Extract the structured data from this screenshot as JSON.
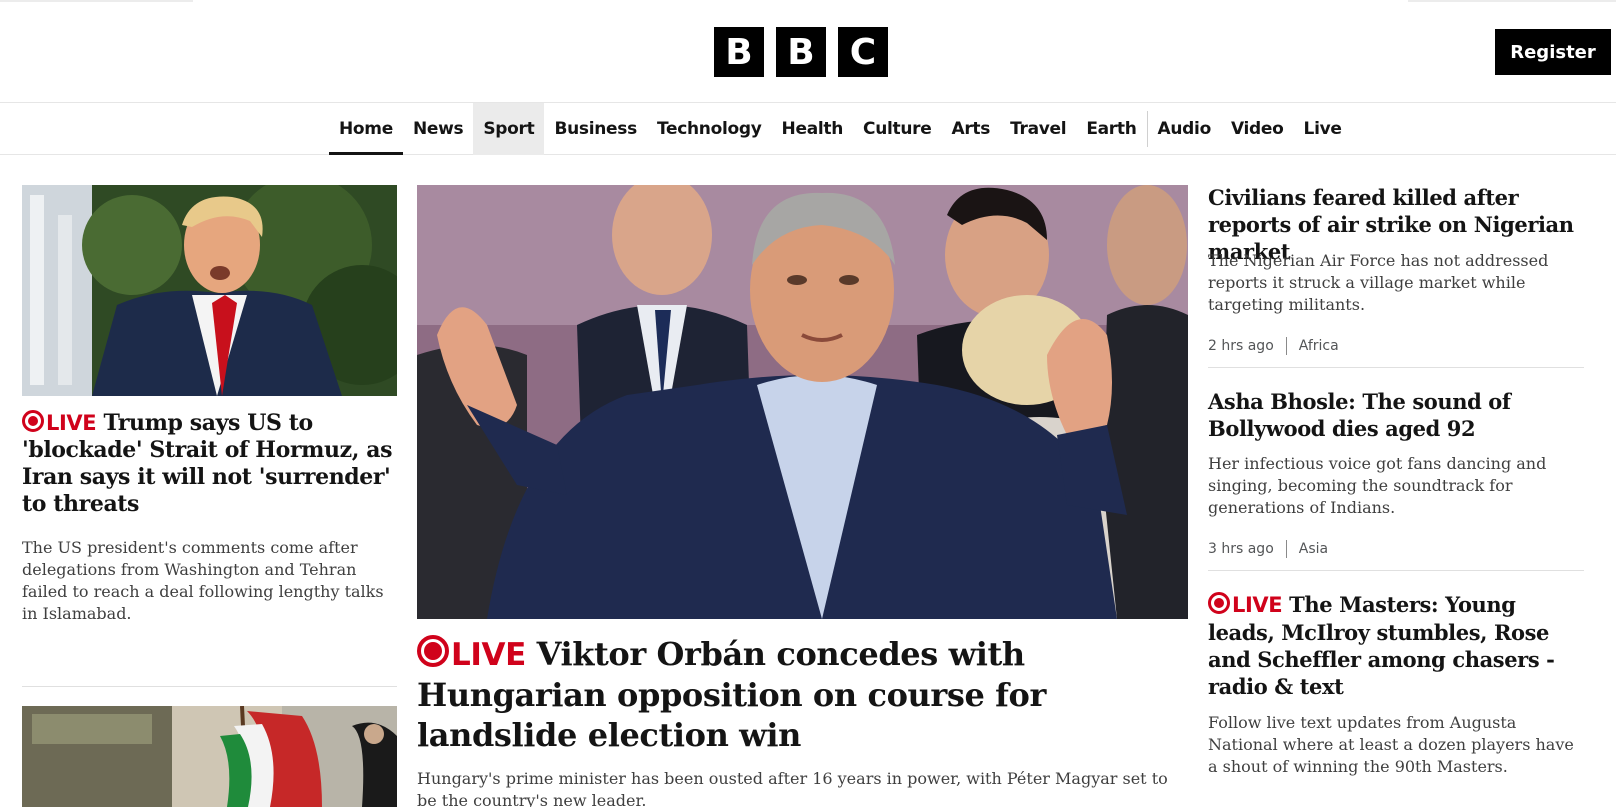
{
  "header": {
    "logo_letters": [
      "B",
      "B",
      "C"
    ],
    "register_label": "Register"
  },
  "nav": {
    "items": [
      "Home",
      "News",
      "Sport",
      "Business",
      "Technology",
      "Health",
      "Culture",
      "Arts",
      "Travel",
      "Earth",
      "Audio",
      "Video",
      "Live"
    ],
    "active": "Home",
    "hovered": "Sport"
  },
  "left_column": {
    "story1": {
      "image": "trump-photo",
      "live_label": "LIVE",
      "headline": "Trump says US to 'blockade' Strait of Hormuz, as Iran says it will not 'surrender' to threats",
      "summary": "The US president's comments come after delegations from Washington and Tehran failed to reach a deal following lengthy talks in Islamabad."
    },
    "story2": {
      "image": "iran-flag-photo"
    }
  },
  "main_story": {
    "image": "orban-photo",
    "live_label": "LIVE",
    "headline": "Viktor Orbán concedes with Hungarian opposition on course for landslide election win",
    "summary": "Hungary's prime minister has been ousted after 16 years in power, with Péter Magyar set to be the country's new leader."
  },
  "right_column": {
    "stories": [
      {
        "headline": "Civilians feared killed after reports of air strike on Nigerian market",
        "summary": "The Nigerian Air Force has not addressed reports it struck a village market while targeting militants.",
        "time": "2 hrs ago",
        "section": "Africa"
      },
      {
        "headline": "Asha Bhosle: The sound of Bollywood dies aged 92",
        "summary": "Her infectious voice got fans dancing and singing, becoming the soundtrack for generations of Indians.",
        "time": "3 hrs ago",
        "section": "Asia"
      },
      {
        "live_label": "LIVE",
        "headline": "The Masters: Young leads, McIlroy stumbles, Rose and Scheffler among chasers - radio & text",
        "summary": "Follow live text updates from Augusta National where at least a dozen players have a shout of winning the 90th Masters."
      }
    ]
  },
  "colors": {
    "live_red": "#d0021b",
    "text": "#141414",
    "brand_black": "#000000"
  }
}
